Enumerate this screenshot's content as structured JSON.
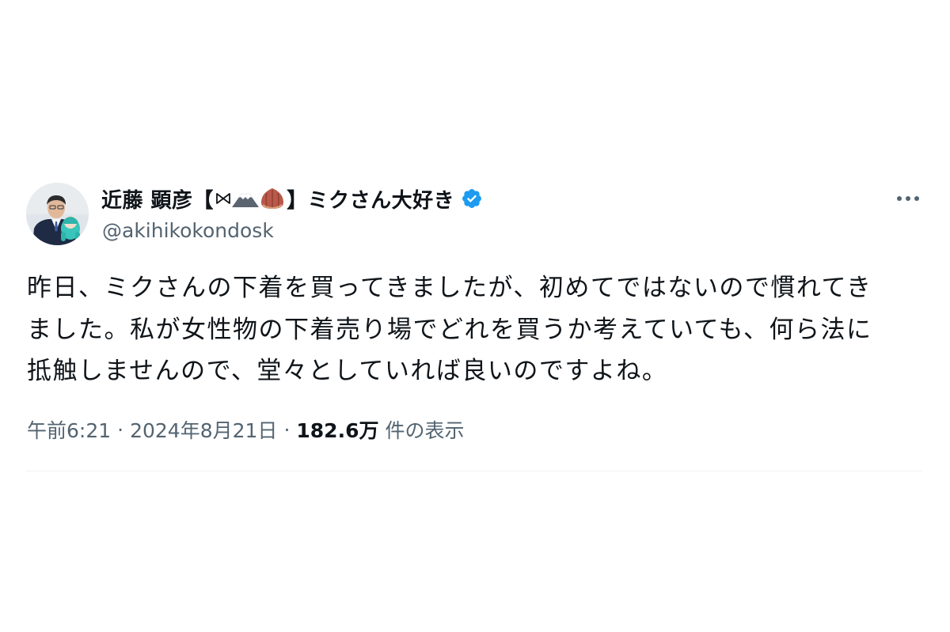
{
  "tweet": {
    "author": {
      "name_prefix": "近藤 顕彦【",
      "name_suffix": "】ミクさん大好き",
      "name_icons": [
        "bowtie-icon",
        "mount-fuji-icon",
        "chestnut-icon"
      ],
      "verified_icon": "verified-badge-icon",
      "handle": "@akihikokondosk"
    },
    "more_icon": "more-horizontal-icon",
    "body_lines": [
      "昨日、ミクさんの下着を買ってきましたが、初めてではないので慣れてき",
      "ました。私が女性物の下着売り場でどれを買うか考えていても、何ら法に",
      "抵触しませんので、堂々としていれば良いのですよね。"
    ],
    "time": "午前6:21",
    "separator": "·",
    "date": "2024年8月21日",
    "views_count": "182.6万",
    "views_label": "件の表示"
  },
  "colors": {
    "text_primary": "#0f1419",
    "text_secondary": "#536471",
    "verified_blue": "#1d9bf0",
    "divider": "#eff3f4"
  }
}
